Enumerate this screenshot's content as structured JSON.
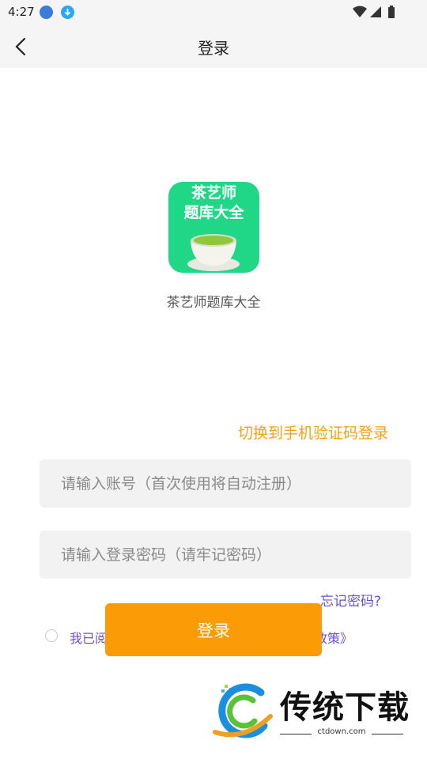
{
  "status_bar": {
    "time": "4:27"
  },
  "header": {
    "title": "登录"
  },
  "app": {
    "icon_lines": [
      "茶艺师",
      "题库大全"
    ],
    "name": "茶艺师题库大全"
  },
  "login": {
    "switch_mode_label": "切换到手机验证码登录",
    "account_placeholder": "请输入账号（首次使用将自动注册）",
    "account_value": "",
    "password_placeholder": "请输入登录密码（请牢记密码）",
    "password_value": "",
    "forgot_label": "忘记密码?",
    "agreement_prefix": "我已阅",
    "agreement_suffix": "政策》",
    "submit_label": "登录"
  },
  "watermark": {
    "title": "传统下载",
    "url": "ctdown.com"
  },
  "colors": {
    "accent_orange": "#fb9c06",
    "link_yellow": "#f5a311",
    "link_purple": "#6a4fd8",
    "icon_green": "#1fd787"
  }
}
